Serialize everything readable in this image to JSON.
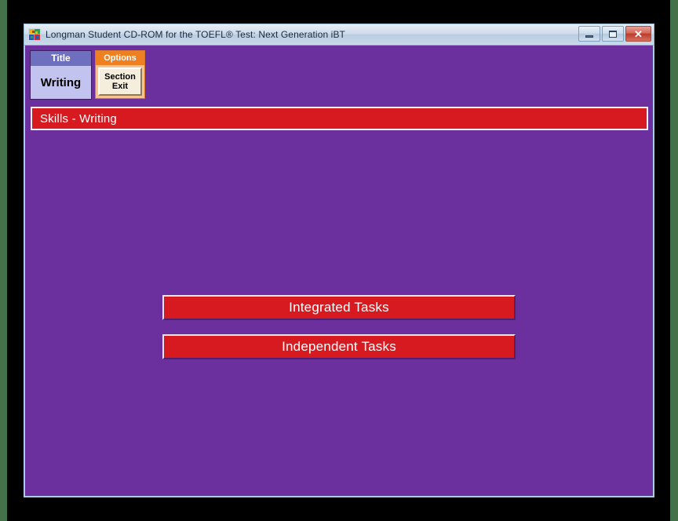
{
  "window": {
    "title": "Longman Student CD-ROM for the TOEFL® Test: Next Generation iBT",
    "icon": "app-mosaic-icon",
    "controls": {
      "minimize_label": "",
      "maximize_label": "",
      "close_label": "✕"
    }
  },
  "panels": {
    "title_panel": {
      "header": "Title",
      "value": "Writing"
    },
    "options_panel": {
      "header": "Options",
      "button_line1": "Section",
      "button_line2": "Exit"
    }
  },
  "banner": {
    "text": "Skills - Writing"
  },
  "tasks": [
    {
      "label": "Integrated Tasks"
    },
    {
      "label": "Independent Tasks"
    }
  ],
  "colors": {
    "accent_red": "#d71920",
    "background_purple": "#6b2f9e",
    "options_orange": "#ef8022",
    "title_blue": "#6f6fc0",
    "desktop_green": "#44704a"
  }
}
